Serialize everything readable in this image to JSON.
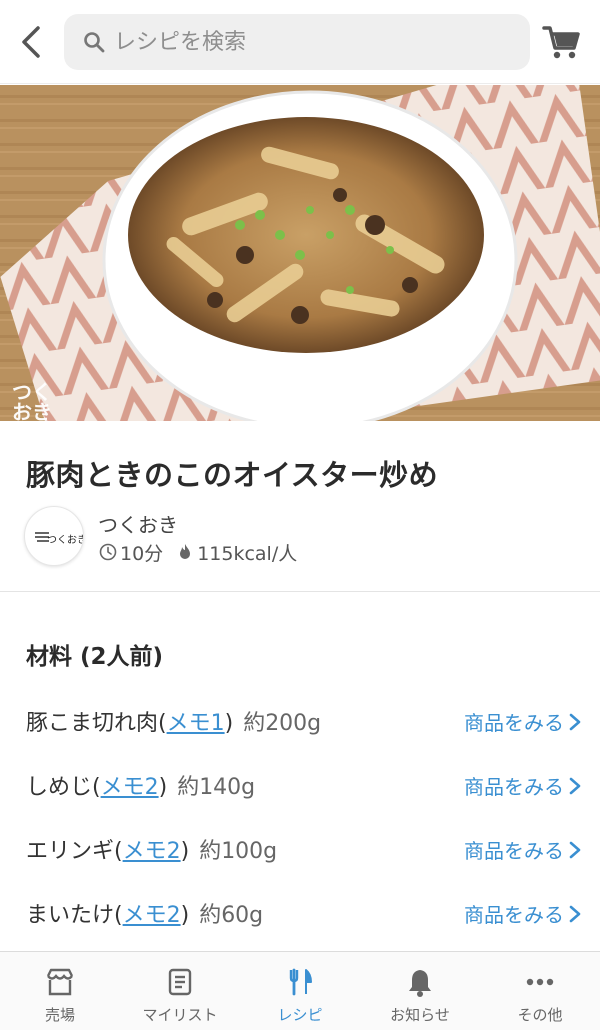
{
  "header": {
    "back_icon": "chevron-left-icon",
    "search_placeholder": "レシピを検索",
    "search_icon": "search-icon",
    "cart_icon": "cart-icon"
  },
  "hero": {
    "watermark": "つく おき"
  },
  "recipe": {
    "title": "豚肉ときのこのオイスター炒め",
    "author": "つくおき",
    "avatar_text": "つくおき",
    "time": "10分",
    "calories": "115kcal/人"
  },
  "ingredients": {
    "heading": "材料 (2人前)",
    "shop_label": "商品をみる",
    "items": [
      {
        "name": "豚こま切れ肉(",
        "memo": "メモ1",
        "close": ")",
        "amount": "約200g"
      },
      {
        "name": "しめじ(",
        "memo": "メモ2",
        "close": ")",
        "amount": "約140g"
      },
      {
        "name": "エリンギ(",
        "memo": "メモ2",
        "close": ")",
        "amount": "約100g"
      },
      {
        "name": "まいたけ(",
        "memo": "メモ2",
        "close": ")",
        "amount": "約60g"
      }
    ]
  },
  "nav": {
    "active_color": "#3a8fd1",
    "items": [
      {
        "label": "売場",
        "icon": "store-icon"
      },
      {
        "label": "マイリスト",
        "icon": "list-icon"
      },
      {
        "label": "レシピ",
        "icon": "fork-knife-icon"
      },
      {
        "label": "お知らせ",
        "icon": "bell-icon"
      },
      {
        "label": "その他",
        "icon": "more-icon"
      }
    ]
  }
}
